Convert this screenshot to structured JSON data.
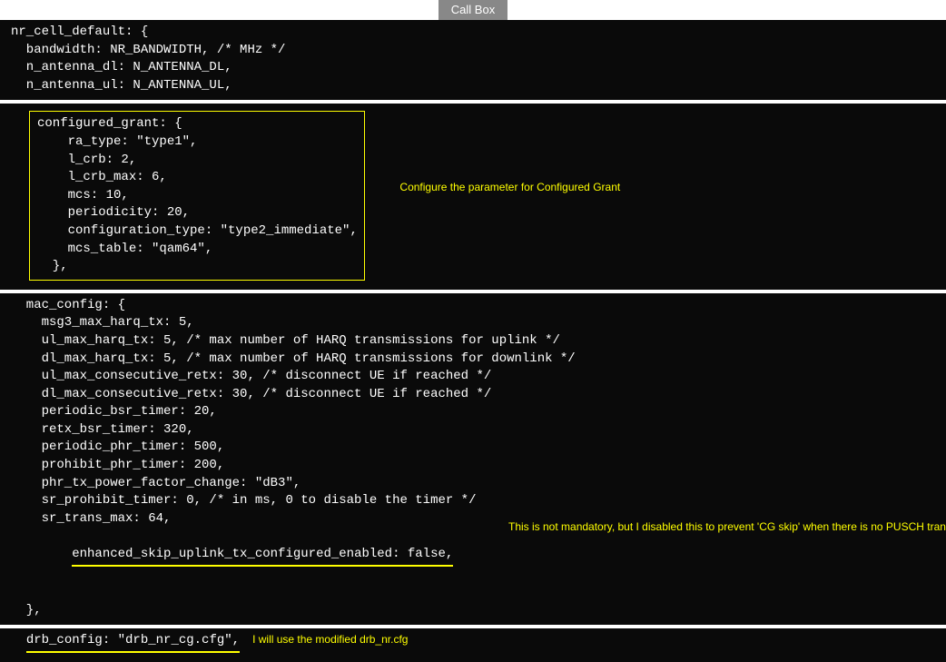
{
  "tab": {
    "label": "Call Box"
  },
  "panel1": {
    "l1": "nr_cell_default: {",
    "l2": "  bandwidth: NR_BANDWIDTH, /* MHz */",
    "l3": "  n_antenna_dl: N_ANTENNA_DL,",
    "l4": "  n_antenna_ul: N_ANTENNA_UL,"
  },
  "panel2": {
    "box": {
      "l1": "configured_grant: {",
      "l2": "    ra_type: \"type1\",",
      "l3": "    l_crb: 2,",
      "l4": "    l_crb_max: 6,",
      "l5": "    mcs: 10,",
      "l6": "    periodicity: 20,",
      "l7": "    configuration_type: \"type2_immediate\",",
      "l8": "    mcs_table: \"qam64\",",
      "l9": "  },"
    },
    "annotation": "Configure the parameter for Configured Grant"
  },
  "panel3": {
    "l1": "  mac_config: {",
    "l2": "    msg3_max_harq_tx: 5,",
    "l3": "    ul_max_harq_tx: 5, /* max number of HARQ transmissions for uplink */",
    "l4": "    dl_max_harq_tx: 5, /* max number of HARQ transmissions for downlink */",
    "l5": "    ul_max_consecutive_retx: 30, /* disconnect UE if reached */",
    "l6": "    dl_max_consecutive_retx: 30, /* disconnect UE if reached */",
    "l7": "    periodic_bsr_timer: 20,",
    "l8": "    retx_bsr_timer: 320,",
    "l9": "    periodic_phr_timer: 500,",
    "l10": "    prohibit_phr_timer: 200,",
    "l11": "    phr_tx_power_factor_change: \"dB3\",",
    "l12": "    sr_prohibit_timer: 0, /* in ms, 0 to disable the timer */",
    "l13": "    sr_trans_max: 64,",
    "under_prefix": "    ",
    "under_text": "enhanced_skip_uplink_tx_configured_enabled: false,",
    "l15": "  },",
    "annotation": "This is not mandatory, but I disabled this to prevent 'CG skip' when there is no PUSCH transmission."
  },
  "panel4": {
    "prefix": "  ",
    "under_text": "drb_config: \"drb_nr_cg.cfg\",",
    "annotation": "I will use the modified drb_nr.cfg"
  }
}
